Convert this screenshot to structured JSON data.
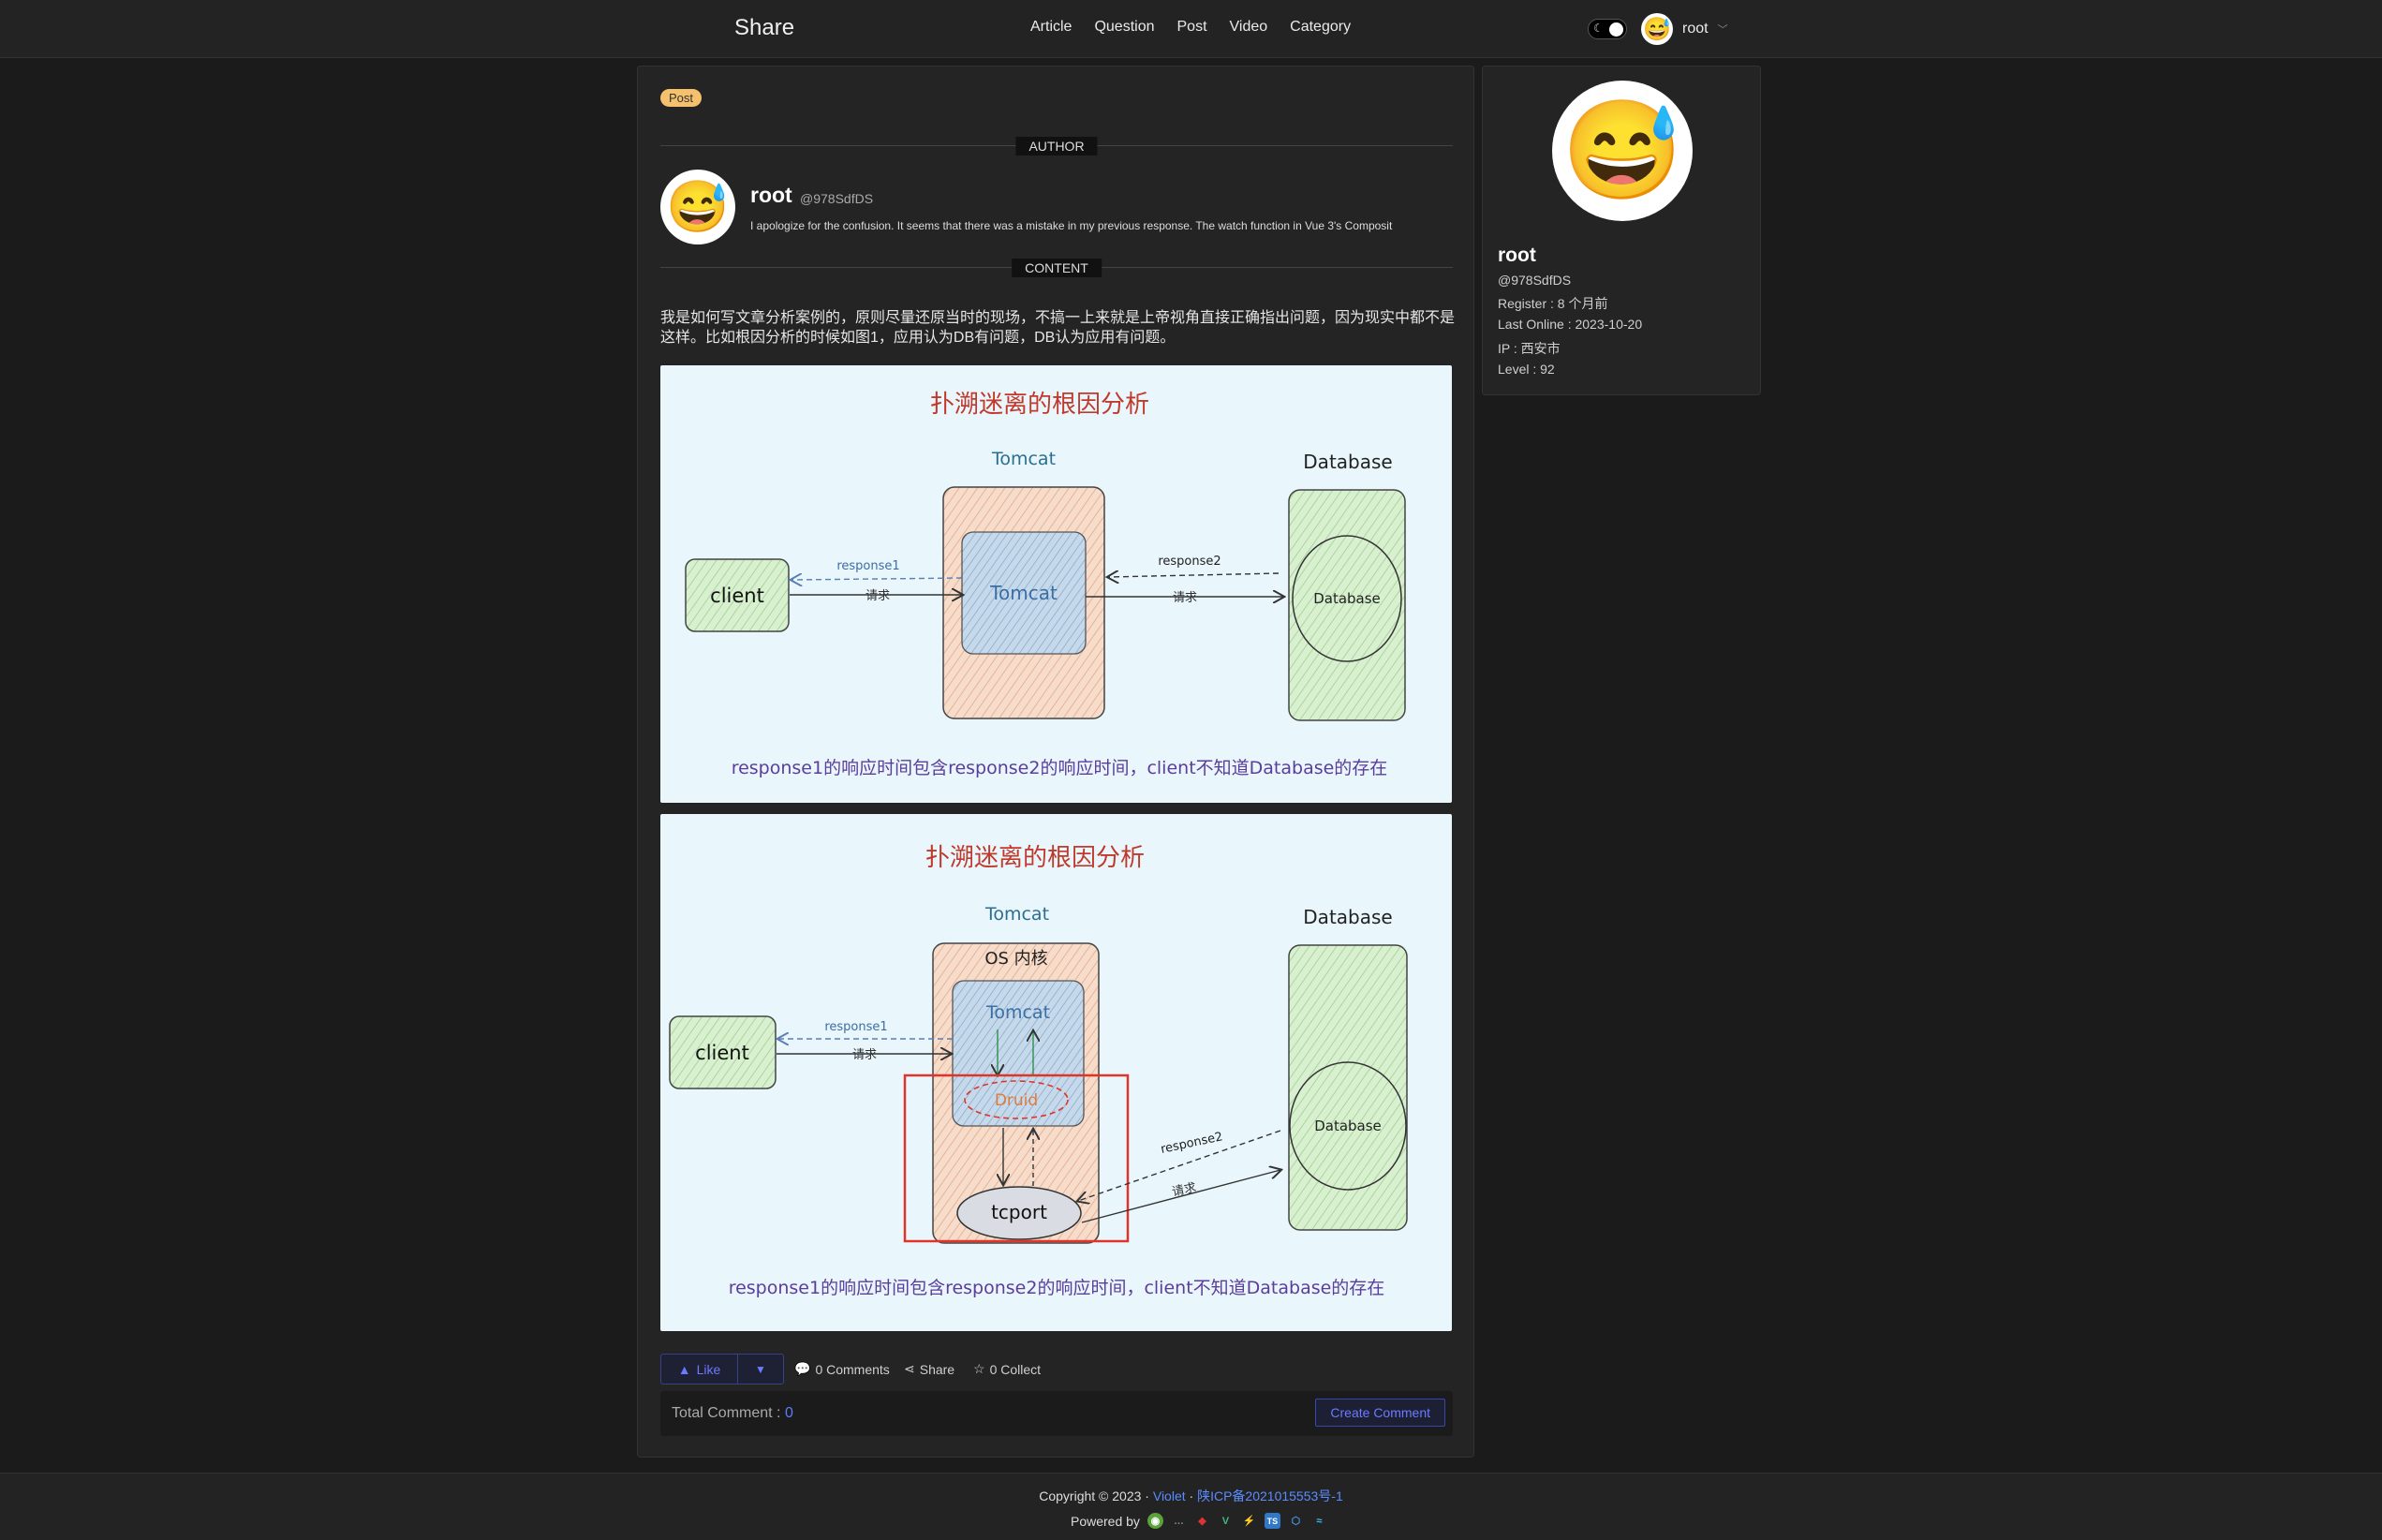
{
  "header": {
    "brand": "Share",
    "nav": [
      "Article",
      "Question",
      "Post",
      "Video",
      "Category"
    ],
    "user_name": "root",
    "avatar_emoji": "😅"
  },
  "post": {
    "tag": "Post",
    "author_divider": "AUTHOR",
    "content_divider": "CONTENT",
    "author": {
      "name": "root",
      "handle": "@978SdfDS",
      "bio": "I apologize for the confusion. It seems that there was a mistake in my previous response. The watch function in Vue 3's Composit",
      "avatar_emoji": "😅"
    },
    "content": "我是如何写文章分析案例的，原则尽量还原当时的现场，不搞一上来就是上帝视角直接正确指出问题，因为现实中都不是这样。比如根因分析的时候如图1，应用认为DB有问题，DB认为应用有问题。",
    "figure1": {
      "title": "扑溯迷离的根因分析",
      "tomcat_label": "Tomcat",
      "database_label": "Database",
      "client": "client",
      "tomcat_inner": "Tomcat",
      "database_inner": "Database",
      "response1": "response1",
      "response2": "response2",
      "request": "请求",
      "caption": "response1的响应时间包含response2的响应时间，client不知道Database的存在"
    },
    "figure2": {
      "title": "扑溯迷离的根因分析",
      "tomcat_label": "Tomcat",
      "database_label": "Database",
      "os_kernel": "OS 内核",
      "client": "client",
      "tomcat_inner": "Tomcat",
      "druid": "Druid",
      "tcport": "tcport",
      "database_inner": "Database",
      "response1": "response1",
      "response2": "response2",
      "request": "请求",
      "caption": "response1的响应时间包含response2的响应时间，client不知道Database的存在"
    },
    "actions": {
      "like": "Like",
      "comments": "0 Comments",
      "share": "Share",
      "collect": "0 Collect"
    },
    "comments": {
      "total_label": "Total Comment : ",
      "total_value": "0",
      "create_button": "Create Comment"
    }
  },
  "profile": {
    "name": "root",
    "handle": "@978SdfDS",
    "register": "Register : 8 个月前",
    "last_online": "Last Online : 2023-10-20",
    "ip": "IP : 西安市",
    "level": "Level : 92",
    "avatar_emoji": "😅"
  },
  "footer": {
    "copyright": "Copyright © 2023 · ",
    "violet": "Violet",
    "sep": " · ",
    "icp": "陕ICP备2021015553号-1",
    "powered_by": "Powered by"
  },
  "colors": {
    "accent": "#5b7cff",
    "tag_bg": "#f5c16c",
    "figure_bg": "#e9f6fc",
    "highlight_red": "#e0342a"
  }
}
